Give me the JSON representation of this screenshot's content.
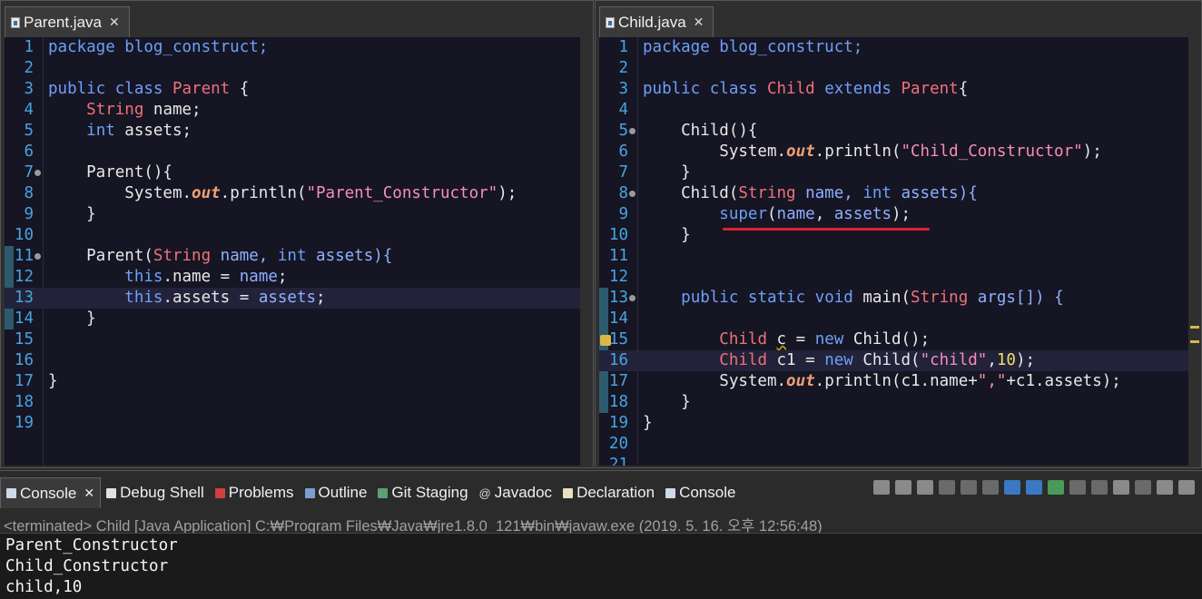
{
  "left_editor": {
    "tab_label": "Parent.java",
    "close_glyph": "✕",
    "lines": [
      {
        "n": "1"
      },
      {
        "n": "2"
      },
      {
        "n": "3"
      },
      {
        "n": "4"
      },
      {
        "n": "5"
      },
      {
        "n": "6"
      },
      {
        "n": "7"
      },
      {
        "n": "8"
      },
      {
        "n": "9"
      },
      {
        "n": "10"
      },
      {
        "n": "11"
      },
      {
        "n": "12"
      },
      {
        "n": "13"
      },
      {
        "n": "14"
      },
      {
        "n": "15"
      },
      {
        "n": "16"
      },
      {
        "n": "17"
      },
      {
        "n": "18"
      },
      {
        "n": "19"
      }
    ]
  },
  "right_editor": {
    "tab_label": "Child.java",
    "close_glyph": "✕",
    "lines": [
      {
        "n": "1"
      },
      {
        "n": "2"
      },
      {
        "n": "3"
      },
      {
        "n": "4"
      },
      {
        "n": "5"
      },
      {
        "n": "6"
      },
      {
        "n": "7"
      },
      {
        "n": "8"
      },
      {
        "n": "9"
      },
      {
        "n": "10"
      },
      {
        "n": "11"
      },
      {
        "n": "12"
      },
      {
        "n": "13"
      },
      {
        "n": "14"
      },
      {
        "n": "15"
      },
      {
        "n": "16"
      },
      {
        "n": "17"
      },
      {
        "n": "18"
      },
      {
        "n": "19"
      },
      {
        "n": "20"
      },
      {
        "n": "21"
      }
    ]
  },
  "code_left": {
    "l1": "package blog_construct;",
    "l3a": "public class ",
    "l3b": "Parent",
    "l3c": " {",
    "l4a": "    ",
    "l4b": "String",
    "l4c": " name;",
    "l5a": "    ",
    "l5b": "int",
    "l5c": " assets;",
    "l7": "    Parent(){",
    "l8a": "        System.",
    "l8b": "out",
    "l8c": ".println(",
    "l8d": "\"Parent_Constructor\"",
    "l8e": ");",
    "l9": "    }",
    "l11a": "    Parent(",
    "l11b": "String",
    "l11c": " name, ",
    "l11d": "int",
    "l11e": " assets){",
    "l12a": "        ",
    "l12b": "this",
    "l12c": ".name = ",
    "l12d": "name",
    "l12e": ";",
    "l13a": "        ",
    "l13b": "this",
    "l13c": ".assets = ",
    "l13d": "assets",
    "l13e": ";",
    "l14": "    }",
    "l17": "}"
  },
  "code_right": {
    "l1": "package blog_construct;",
    "l3a": "public class ",
    "l3b": "Child",
    "l3c": " extends ",
    "l3d": "Parent",
    "l3e": "{",
    "l5": "    Child(){",
    "l6a": "        System.",
    "l6b": "out",
    "l6c": ".println(",
    "l6d": "\"Child_Constructor\"",
    "l6e": ");",
    "l7": "    }",
    "l8a": "    Child(",
    "l8b": "String",
    "l8c": " name, ",
    "l8d": "int",
    "l8e": " assets){",
    "l9a": "        ",
    "l9b": "super",
    "l9c": "(",
    "l9d": "name",
    "l9e": ", ",
    "l9f": "assets",
    "l9g": ");",
    "l10": "    }",
    "l13a": "    ",
    "l13b": "public static void",
    "l13c": " main(",
    "l13d": "String",
    "l13e": " args[]) {",
    "l15a": "        ",
    "l15b": "Child",
    "l15c": " ",
    "l15d": "c",
    "l15e": " = ",
    "l15f": "new",
    "l15g": " Child();",
    "l16a": "        ",
    "l16b": "Child",
    "l16c": " c1 = ",
    "l16d": "new",
    "l16e": " Child(",
    "l16f": "\"child\"",
    "l16g": ",",
    "l16h": "10",
    "l16i": ");",
    "l17a": "        System.",
    "l17b": "out",
    "l17c": ".println(c1.name+",
    "l17d": "\",\"",
    "l17e": "+c1.assets);",
    "l18": "    }",
    "l19": "}"
  },
  "console": {
    "tabs": [
      "Console",
      "Debug Shell",
      "Problems",
      "Outline",
      "Git Staging",
      "Javadoc",
      "Declaration",
      "Console"
    ],
    "tab_close": "✕",
    "status": "<terminated> Child [Java Application] C:₩Program Files₩Java₩jre1.8.0_121₩bin₩javaw.exe (2019. 5. 16. 오후 12:56:48)",
    "output": [
      "Parent_Constructor",
      "Child_Constructor",
      "child,10"
    ]
  },
  "colors": {
    "editor_bg": "#151524",
    "keyword": "#6fa0f6",
    "type": "#f07178",
    "string": "#f78fb3",
    "line_number": "#4aa3df",
    "annotation_underline": "#e0202a"
  }
}
